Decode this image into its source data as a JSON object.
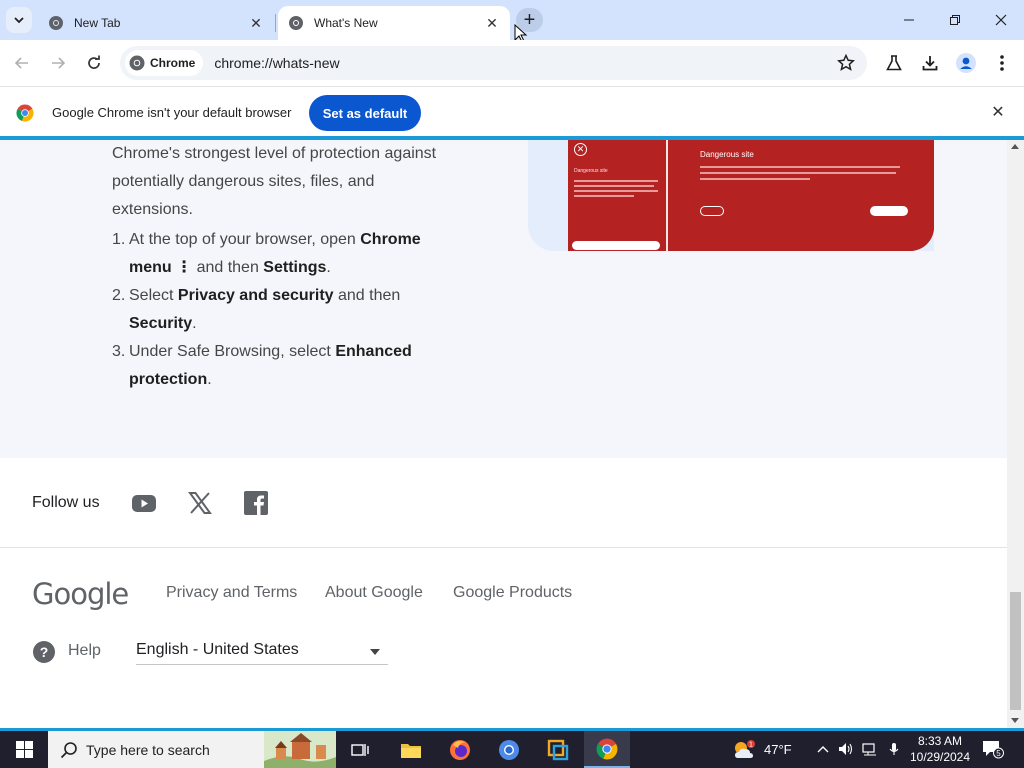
{
  "tabs": [
    {
      "title": "New Tab",
      "active": false
    },
    {
      "title": "What's New",
      "active": true
    }
  ],
  "omnibox": {
    "chip_label": "Chrome",
    "url": "chrome://whats-new"
  },
  "infobar": {
    "message": "Google Chrome isn't your default browser",
    "button": "Set as default"
  },
  "content": {
    "intro": "Chrome's strongest level of protection against potentially dangerous sites, files, and extensions.",
    "steps": [
      {
        "num": "1.",
        "t1": "At the top of your browser, open ",
        "b1": "Chrome menu",
        "kebab": "⋮",
        "t2": " and then ",
        "b2": "Settings",
        "t3": "."
      },
      {
        "num": "2.",
        "t1": "Select ",
        "b1": "Privacy and security",
        "t2": " and then ",
        "b2": "Security",
        "t3": "."
      },
      {
        "num": "3.",
        "t1": "Under Safe Browsing, select ",
        "b1": "Enhanced protection",
        "t3": "."
      }
    ],
    "illustration_title": "Dangerous site",
    "illustration_title_small": "Dangerous site"
  },
  "follow": {
    "label": "Follow us",
    "icons": [
      "youtube-icon",
      "x-icon",
      "facebook-icon"
    ]
  },
  "footer": {
    "logo": "Google",
    "links": [
      "Privacy and Terms",
      "About Google",
      "Google Products"
    ],
    "help": "Help",
    "language": "English - United States"
  },
  "taskbar": {
    "search_placeholder": "Type here to search",
    "temperature": "47°F",
    "weather_badge": "1",
    "time": "8:33 AM",
    "date": "10/29/2024",
    "notifications": "5"
  },
  "colors": {
    "accent": "#0b57d0",
    "tabstrip": "#d3e3fd",
    "alert_red": "#b42222",
    "taskbar": "#1f1f2e"
  }
}
